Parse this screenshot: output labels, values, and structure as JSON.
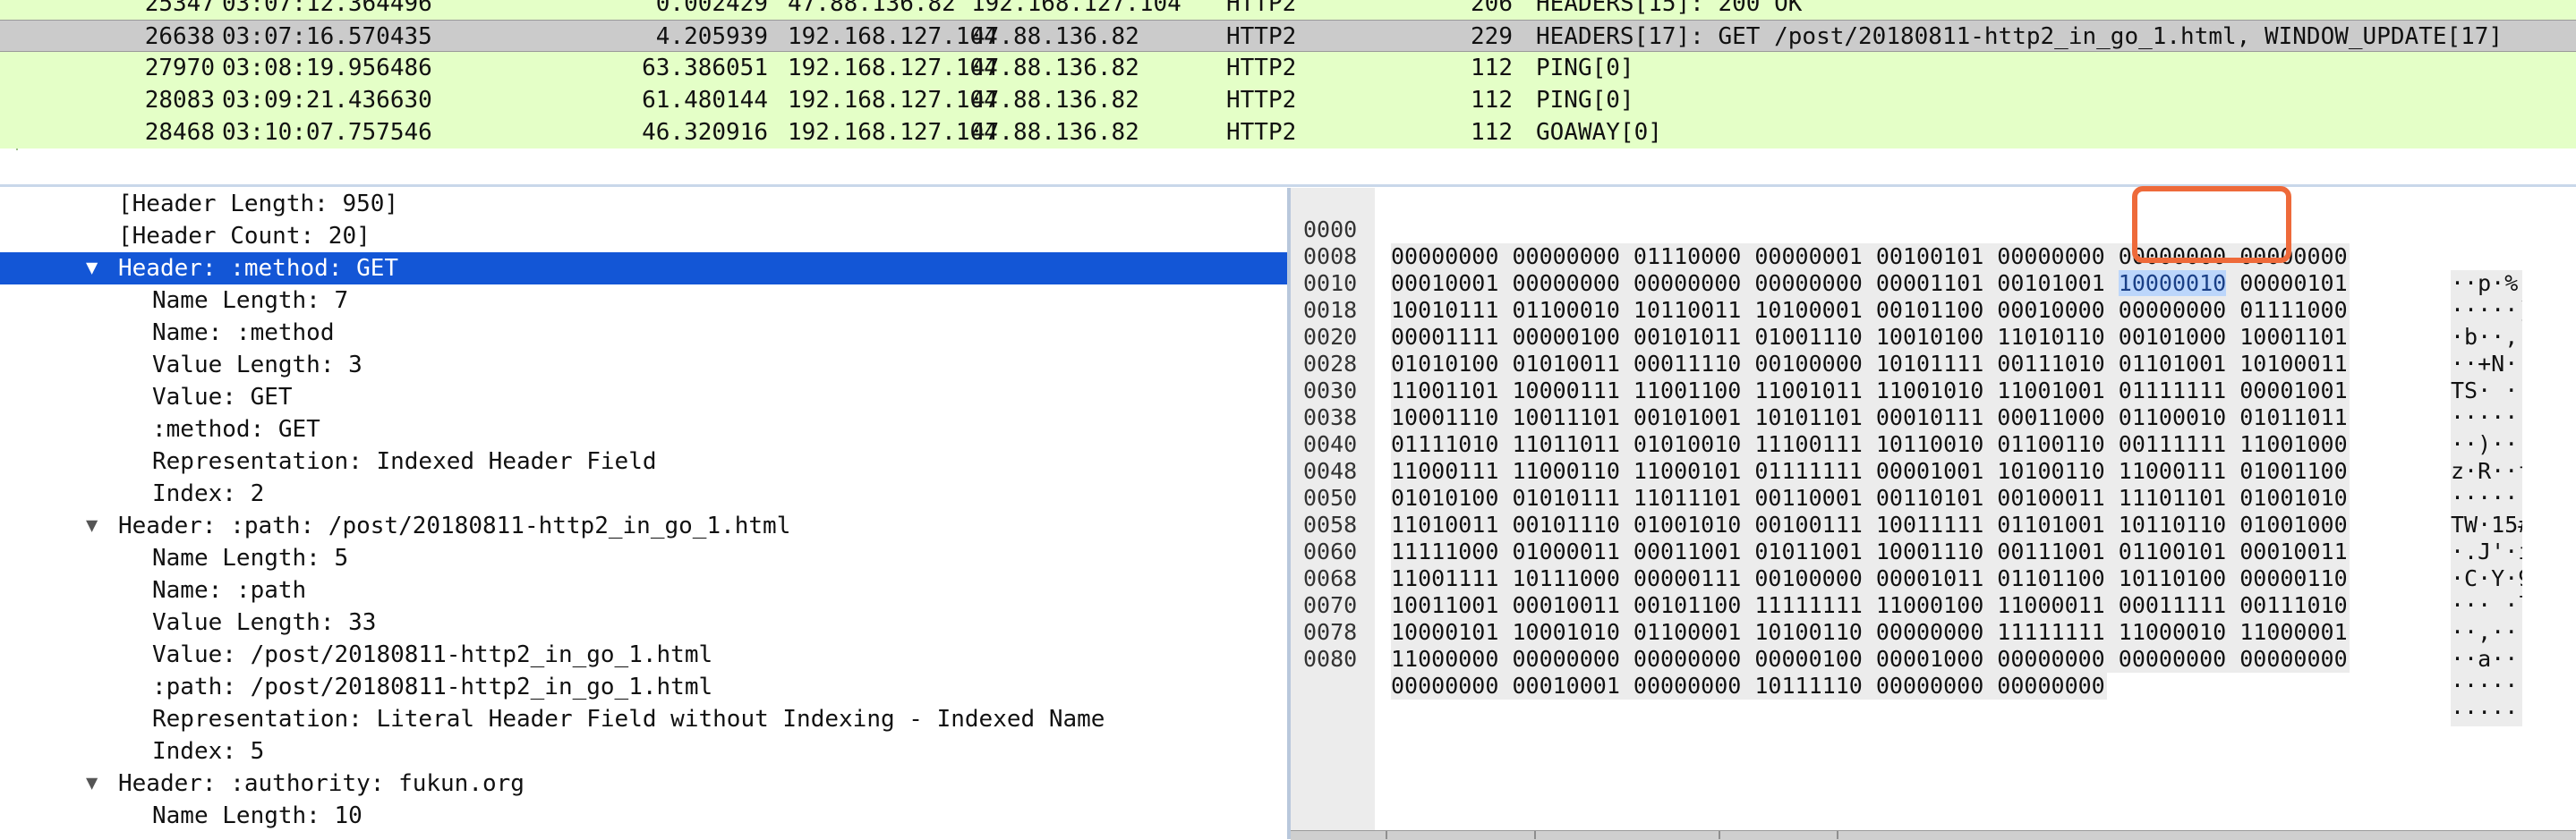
{
  "packets": [
    {
      "no": "25347",
      "time": "03:07:12.364496",
      "delta": "0.002429",
      "src": "47.88.136.82",
      "dst": "192.168.127.104",
      "proto": "HTTP2",
      "len": "206",
      "info": "HEADERS[15]: 200 OK"
    },
    {
      "no": "26638",
      "time": "03:07:16.570435",
      "delta": "4.205939",
      "src": "192.168.127.104",
      "dst": "47.88.136.82",
      "proto": "HTTP2",
      "len": "229",
      "info": "HEADERS[17]: GET /post/20180811-http2_in_go_1.html, WINDOW_UPDATE[17]"
    },
    {
      "no": "27970",
      "time": "03:08:19.956486",
      "delta": "63.386051",
      "src": "192.168.127.104",
      "dst": "47.88.136.82",
      "proto": "HTTP2",
      "len": "112",
      "info": "PING[0]"
    },
    {
      "no": "28083",
      "time": "03:09:21.436630",
      "delta": "61.480144",
      "src": "192.168.127.104",
      "dst": "47.88.136.82",
      "proto": "HTTP2",
      "len": "112",
      "info": "PING[0]"
    },
    {
      "no": "28468",
      "time": "03:10:07.757546",
      "delta": "46.320916",
      "src": "192.168.127.104",
      "dst": "47.88.136.82",
      "proto": "HTTP2",
      "len": "112",
      "info": "GOAWAY[0]"
    }
  ],
  "details": [
    {
      "text": "[Header Length: 950]",
      "indent": 1,
      "arrow": ""
    },
    {
      "text": "[Header Count: 20]",
      "indent": 1,
      "arrow": ""
    },
    {
      "text": "Header: :method: GET",
      "indent": 1,
      "arrow": "▼"
    },
    {
      "text": "Name Length: 7",
      "indent": 2,
      "arrow": ""
    },
    {
      "text": "Name: :method",
      "indent": 2,
      "arrow": ""
    },
    {
      "text": "Value Length: 3",
      "indent": 2,
      "arrow": ""
    },
    {
      "text": "Value: GET",
      "indent": 2,
      "arrow": ""
    },
    {
      "text": ":method: GET",
      "indent": 2,
      "arrow": ""
    },
    {
      "text": "Representation: Indexed Header Field",
      "indent": 2,
      "arrow": ""
    },
    {
      "text": "Index: 2",
      "indent": 2,
      "arrow": ""
    },
    {
      "text": "Header: :path: /post/20180811-http2_in_go_1.html",
      "indent": 1,
      "arrow": "▼"
    },
    {
      "text": "Name Length: 5",
      "indent": 2,
      "arrow": ""
    },
    {
      "text": "Name: :path",
      "indent": 2,
      "arrow": ""
    },
    {
      "text": "Value Length: 33",
      "indent": 2,
      "arrow": ""
    },
    {
      "text": "Value: /post/20180811-http2_in_go_1.html",
      "indent": 2,
      "arrow": ""
    },
    {
      "text": ":path: /post/20180811-http2_in_go_1.html",
      "indent": 2,
      "arrow": ""
    },
    {
      "text": "Representation: Literal Header Field without Indexing - Indexed Name",
      "indent": 2,
      "arrow": ""
    },
    {
      "text": "Index: 5",
      "indent": 2,
      "arrow": ""
    },
    {
      "text": "Header: :authority: fukun.org",
      "indent": 1,
      "arrow": "▼"
    },
    {
      "text": "Name Length: 10",
      "indent": 2,
      "arrow": ""
    }
  ],
  "bytes": [
    {
      "off": "0000",
      "bits": "00000000 00000000 01110000 00000001 00100101 00000000 00000000 00000000",
      "ascii": "··p·%···"
    },
    {
      "off": "0008",
      "bits_pre": "00010001 00000000 00000000 00000000 00001101 00101001 ",
      "bits_hl": "10000010",
      "bits_post": " 00000101",
      "ascii_pre": "·····)",
      "ascii_hl": "·",
      "ascii_post": "·"
    },
    {
      "off": "0010",
      "bits": "10010111 01100010 10110011 10100001 00101100 00010000 00000000 01111000",
      "ascii": "·b··,··x"
    },
    {
      "off": "0018",
      "bits": "00001111 00000100 00101011 01001110 10010100 11010110 00101000 10001101",
      "ascii": "··+N··(·"
    },
    {
      "off": "0020",
      "bits": "01010100 01010011 00011110 00100000 10101111 00111010 01101001 10100011",
      "ascii": "TS· ·:i·"
    },
    {
      "off": "0028",
      "bits": "11001101 10000111 11001100 11001011 11001010 11001001 01111111 00001001",
      "ascii": "········"
    },
    {
      "off": "0030",
      "bits": "10001110 10011101 00101001 10101101 00010111 00011000 01100010 01011011",
      "ascii": "··)···b["
    },
    {
      "off": "0038",
      "bits": "01111010 11011011 01010010 11100111 10110010 01100110 00111111 11001000",
      "ascii": "z·R··f?·"
    },
    {
      "off": "0040",
      "bits": "11000111 11000110 11000101 01111111 00001001 10100110 11000111 01001100",
      "ascii": "·······L"
    },
    {
      "off": "0048",
      "bits": "01010100 01010111 11011101 00110001 00110101 00100011 11101101 01001010",
      "ascii": "TW·15#·J"
    },
    {
      "off": "0050",
      "bits": "11010011 00101110 01001010 00100111 10011111 01101001 10110110 01001000",
      "ascii": "·.J'·i·H"
    },
    {
      "off": "0058",
      "bits": "11111000 01000011 00011001 01011001 10001110 00111001 01100101 00010011",
      "ascii": "·C·Y·9e·"
    },
    {
      "off": "0060",
      "bits": "11001111 10111000 00000111 00100000 00001011 01101100 10110100 00000110",
      "ascii": "··· ·l··"
    },
    {
      "off": "0068",
      "bits": "10011001 00010011 00101100 11111111 11000100 11000011 00011111 00111010",
      "ascii": "··,····:"
    },
    {
      "off": "0070",
      "bits": "10000101 10001010 01100001 10100110 00000000 11111111 11000010 11000001",
      "ascii": "··a·····"
    },
    {
      "off": "0078",
      "bits": "11000000 00000000 00000000 00000100 00001000 00000000 00000000 00000000",
      "ascii": "········"
    },
    {
      "off": "0080",
      "bits": "00000000 00010001 00000000 10111110 00000000 00000000",
      "ascii": "······"
    }
  ],
  "colors": {
    "packet_row_bg": "#e4ffc7",
    "selected_packet_bg": "#cbcbcb",
    "selected_tree_bg": "#1356d6",
    "byte_highlight": "#bcd6fb",
    "annotation_box": "#ee6a3a"
  }
}
